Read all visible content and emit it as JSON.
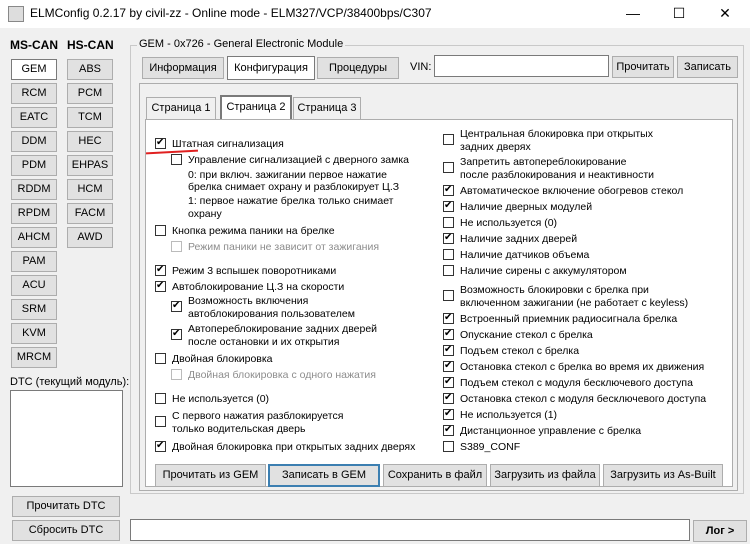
{
  "window": {
    "title": "ELMConfig 0.2.17 by civil-zz - Online mode - ELM327/VCP/38400bps/C307",
    "minimize": "—",
    "maximize": "☐",
    "close": "✕"
  },
  "sidebar": {
    "ms_can_label": "MS-CAN",
    "hs_can_label": "HS-CAN",
    "ms_can": [
      "GEM",
      "RCM",
      "EATC",
      "DDM",
      "PDM",
      "RDDM",
      "RPDM",
      "AHCM",
      "PAM",
      "ACU",
      "SRM",
      "KVM",
      "MRCM"
    ],
    "hs_can": [
      "ABS",
      "PCM",
      "TCM",
      "HEC",
      "EHPAS",
      "HCM",
      "FACM",
      "AWD"
    ],
    "selected": "GEM",
    "dtc_label": "DTC (текущий модуль):",
    "read_dtc": "Прочитать DTC",
    "clear_dtc": "Сбросить DTC"
  },
  "module": {
    "title": "GEM - 0x726 - General Electronic Module",
    "tabs": [
      "Информация",
      "Конфигурация",
      "Процедуры"
    ],
    "active_tab": "Конфигурация",
    "vin_label": "VIN:",
    "vin_value": "",
    "read_btn": "Прочитать",
    "write_btn": "Записать"
  },
  "pages": {
    "tabs": [
      "Страница 1",
      "Страница 2",
      "Страница 3"
    ],
    "active": "Страница 2"
  },
  "left_options": [
    {
      "label": "Штатная сигнализация",
      "checked": true,
      "disabled": false
    },
    {
      "label": "Управление сигнализацией с дверного замка",
      "checked": false,
      "disabled": false
    },
    {
      "label": "Кнопка режима паники на брелке",
      "checked": false,
      "disabled": false
    },
    {
      "label": "Режим паники не зависит от зажигания",
      "checked": false,
      "disabled": true
    },
    {
      "label": "Режим 3 вспышек поворотниками",
      "checked": true,
      "disabled": false
    },
    {
      "label": "Автоблокирование Ц.З на скорости",
      "checked": true,
      "disabled": false
    },
    {
      "label": "Возможность включения",
      "label2": "автоблокирования пользователем",
      "checked": true,
      "disabled": false
    },
    {
      "label": "Автопереблокирование задних дверей",
      "label2": "после остановки и их открытия",
      "checked": true,
      "disabled": false
    },
    {
      "label": "Двойная блокировка",
      "checked": false,
      "disabled": false
    },
    {
      "label": "Двойная блокировка с одного нажатия",
      "checked": false,
      "disabled": true
    },
    {
      "label": "Не используется (0)",
      "checked": false,
      "disabled": false
    },
    {
      "label": "С первого нажатия разблокируется",
      "label2": "только водительская дверь",
      "checked": false,
      "disabled": false
    },
    {
      "label": "Двойная блокировка при открытых задних дверях",
      "checked": true,
      "disabled": false
    }
  ],
  "key_note": {
    "line1": "0:  при включ. зажигании первое нажатие",
    "line2": "брелка снимает охрану и разблокирует Ц.З",
    "line3": "1: первое нажатие брелка только снимает",
    "line4": "охрану"
  },
  "right_options": [
    {
      "label": "Центральная блокировка при открытых",
      "label2": "задних дверях",
      "checked": false
    },
    {
      "label": "Запретить автопереблокирование",
      "label2": "после разблокирования и неактивности",
      "checked": false
    },
    {
      "label": "Автоматическое включение обогревов стекол",
      "checked": true
    },
    {
      "label": "Наличие дверных модулей",
      "checked": true
    },
    {
      "label": "Не используется (0)",
      "checked": false
    },
    {
      "label": "Наличие задних дверей",
      "checked": true
    },
    {
      "label": "Наличие датчиков объема",
      "checked": false
    },
    {
      "label": "Наличие сирены с аккумулятором",
      "checked": false
    },
    {
      "label": "Возможность блокировки с брелка при",
      "label2": "включенном зажигании (не работает с keyless)",
      "checked": false
    },
    {
      "label": "Встроенный приемник радиосигнала брелка",
      "checked": true
    },
    {
      "label": "Опускание стекол с брелка",
      "checked": true
    },
    {
      "label": "Подъем стекол с брелка",
      "checked": true
    },
    {
      "label": "Остановка стекол с брелка во время их движения",
      "checked": true
    },
    {
      "label": "Подъем стекол с модуля бесключевого доступа",
      "checked": true
    },
    {
      "label": "Остановка стекол с модуля бесключевого доступа",
      "checked": true
    },
    {
      "label": "Не используется (1)",
      "checked": true
    },
    {
      "label": "Дистанционное управление с брелка",
      "checked": true
    },
    {
      "label": "S389_CONF",
      "checked": false
    }
  ],
  "bottom_buttons": [
    "Прочитать из GEM",
    "Записать в GEM",
    "Сохранить в файл",
    "Загрузить из файла",
    "Загрузить из As-Built"
  ],
  "log_button": "Лог >"
}
